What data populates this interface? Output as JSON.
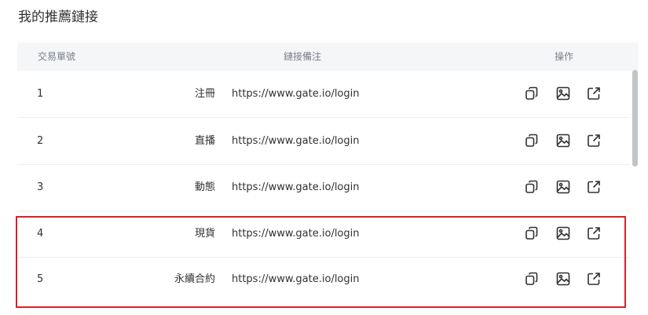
{
  "page": {
    "title": "我的推薦鏈接"
  },
  "table": {
    "headers": {
      "id": "交易單號",
      "note": "鏈接備注",
      "op": "操作"
    },
    "rows": [
      {
        "id": "1",
        "label": "注冊",
        "link": "https://www.gate.io/login"
      },
      {
        "id": "2",
        "label": "直播",
        "link": "https://www.gate.io/login"
      },
      {
        "id": "3",
        "label": "動態",
        "link": "https://www.gate.io/login"
      },
      {
        "id": "4",
        "label": "現貨",
        "link": "https://www.gate.io/login"
      },
      {
        "id": "5",
        "label": "永續合約",
        "link": "https://www.gate.io/login"
      }
    ],
    "actions": [
      "copy-icon",
      "image-icon",
      "open-link-icon"
    ]
  },
  "annotation": {
    "highlight_color": "#d6212b",
    "highlighted_rows": [
      "4",
      "5"
    ]
  },
  "colors": {
    "header_bg": "#f5f6f8",
    "row_border": "#eceef1",
    "icon": "#303133"
  }
}
